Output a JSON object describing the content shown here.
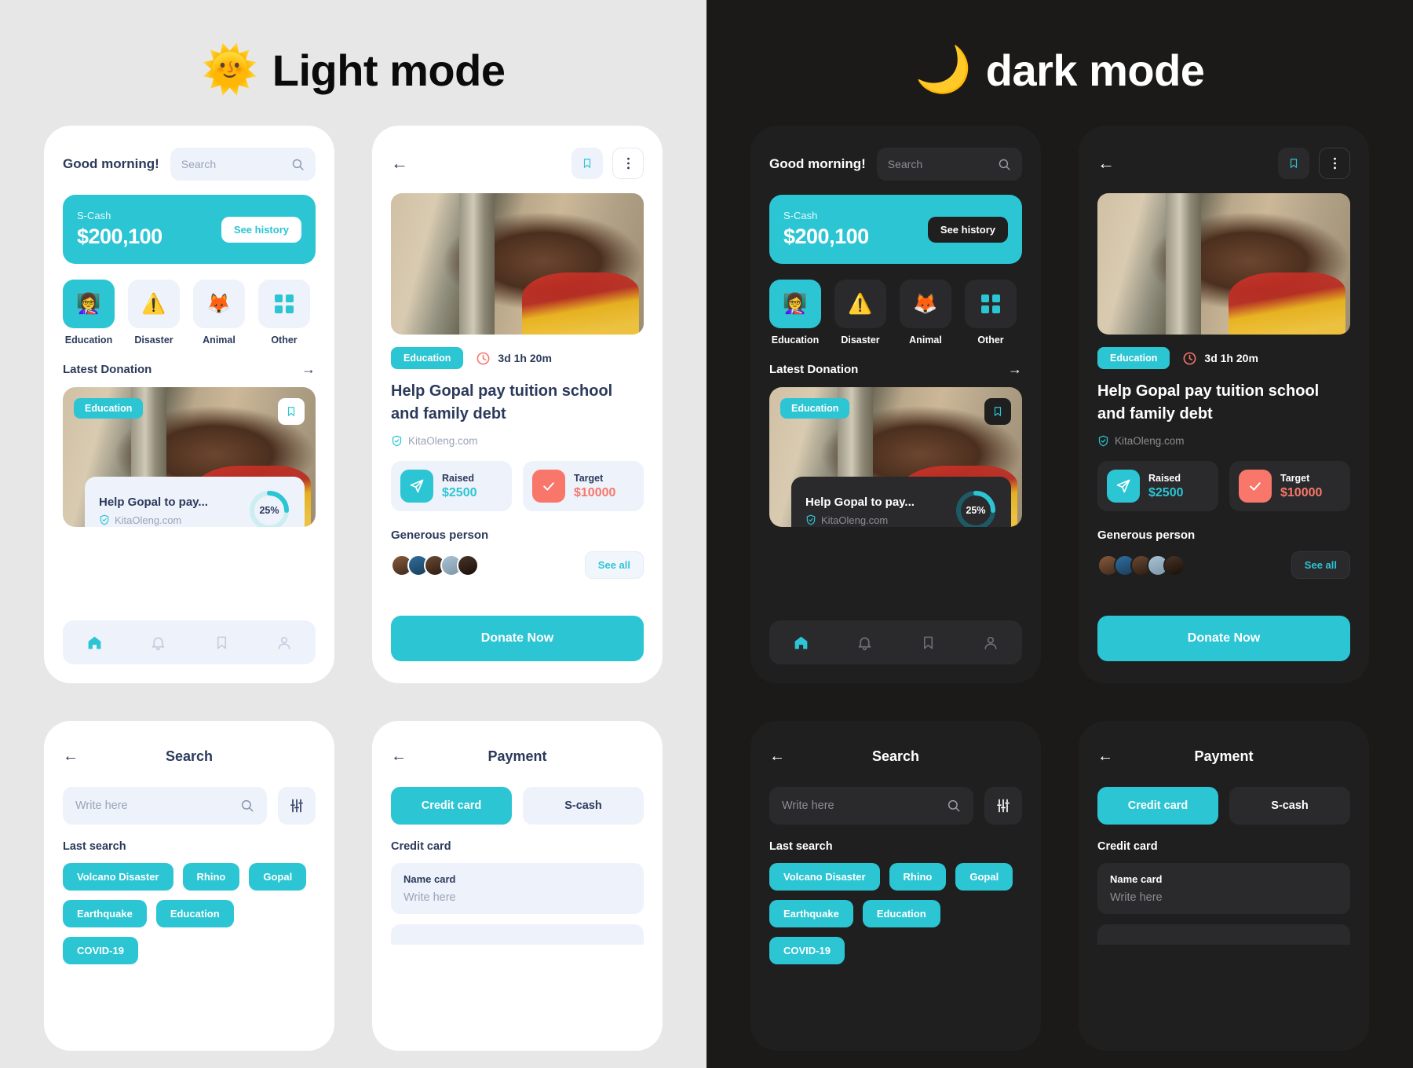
{
  "modes": {
    "light": {
      "emoji": "🌞",
      "title": "Light mode"
    },
    "dark": {
      "emoji": "🌙",
      "title": "dark mode"
    }
  },
  "colors": {
    "accent": "#2cc5d3",
    "coral": "#f8766a",
    "light_bg": "#e7e7e7",
    "dark_bg": "#1b1a19",
    "light_card": "#ffffff",
    "dark_card": "#1f1f1f",
    "light_soft": "#eef2fb",
    "dark_soft": "#2a2a2d",
    "text_navy": "#2b3a5b"
  },
  "home": {
    "greeting": "Good morning!",
    "search_placeholder": "Search",
    "search_icon": "search-icon",
    "wallet": {
      "label": "S-Cash",
      "amount": "$200,100",
      "history_button": "See history"
    },
    "categories": [
      {
        "label": "Education",
        "emoji": "👩‍🏫",
        "icon": "teacher-icon",
        "active": true
      },
      {
        "label": "Disaster",
        "emoji": "⚠️",
        "icon": "warning-icon",
        "active": false
      },
      {
        "label": "Animal",
        "emoji": "🦊",
        "icon": "fox-icon",
        "active": false
      },
      {
        "label": "Other",
        "emoji": "",
        "icon": "grid-icon",
        "active": false
      }
    ],
    "section": {
      "title": "Latest Donation",
      "arrow_icon": "arrow-right-icon"
    },
    "card": {
      "badge": "Education",
      "bookmark_icon": "bookmark-icon",
      "title": "Help Gopal to pay...",
      "source": "KitaOleng.com",
      "source_icon": "verified-shield-icon",
      "progress_pct": 25,
      "progress_label": "25%"
    },
    "bottom_nav": [
      {
        "icon": "home-icon",
        "active": true
      },
      {
        "icon": "bell-icon",
        "active": false
      },
      {
        "icon": "bookmark-icon",
        "active": false
      },
      {
        "icon": "person-icon",
        "active": false
      }
    ]
  },
  "detail": {
    "back_icon": "arrow-left-icon",
    "bookmark_icon": "bookmark-icon",
    "more_icon": "more-vertical-icon",
    "badge": "Education",
    "time_icon": "clock-icon",
    "time_left": "3d 1h 20m",
    "title": "Help Gopal pay tuition school and family debt",
    "source": "KitaOleng.com",
    "source_icon": "verified-shield-icon",
    "stats": [
      {
        "label": "Raised",
        "value": "$2500",
        "icon": "send-icon",
        "accent": "teal"
      },
      {
        "label": "Target",
        "value": "$10000",
        "icon": "check-icon",
        "accent": "coral"
      }
    ],
    "generous_title": "Generous person",
    "see_all": "See all",
    "avatar_count": 5,
    "donate_button": "Donate Now"
  },
  "search": {
    "back_icon": "arrow-left-icon",
    "title": "Search",
    "input_placeholder": "Write here",
    "search_icon": "search-icon",
    "filter_icon": "filter-sliders-icon",
    "last_search_label": "Last search",
    "tags": [
      "Volcano Disaster",
      "Rhino",
      "Gopal",
      "Earthquake",
      "Education",
      "COVID-19"
    ]
  },
  "payment": {
    "back_icon": "arrow-left-icon",
    "title": "Payment",
    "tabs": [
      {
        "label": "Credit card",
        "active": true
      },
      {
        "label": "S-cash",
        "active": false
      }
    ],
    "section_label": "Credit card",
    "fields": [
      {
        "label": "Name card",
        "placeholder": "Write here"
      }
    ]
  }
}
